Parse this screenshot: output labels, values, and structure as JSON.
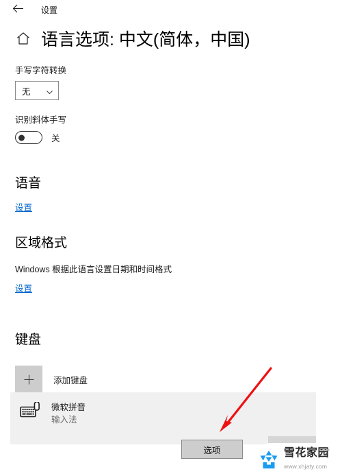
{
  "titlebar": {
    "back_icon": "back-arrow-icon",
    "title": "设置"
  },
  "page": {
    "home_icon": "home-icon",
    "title": "语言选项: 中文(简体，中国)"
  },
  "handwriting": {
    "label": "手写字符转换",
    "dropdown_value": "无",
    "chevron_icon": "chevron-down-icon"
  },
  "cursive": {
    "label": "识别斜体手写",
    "toggle_state": "关",
    "toggle_on": false
  },
  "speech": {
    "title": "语音",
    "settings_link": "设置"
  },
  "region": {
    "title": "区域格式",
    "description": "Windows 根据此语言设置日期和时间格式",
    "settings_link": "设置"
  },
  "keyboard": {
    "title": "键盘",
    "add_icon": "plus-icon",
    "add_label": "添加键盘",
    "ime": {
      "icon": "keyboard-icon",
      "name": "微软拼音",
      "subtitle": "输入法",
      "options_button": "选项"
    }
  },
  "annotation": {
    "arrow_color": "#ee1111",
    "arrow_name": "red-pointer-arrow"
  },
  "watermark": {
    "logo_icon": "snowflake-logo-icon",
    "name": "雪花家园",
    "url": "www.xhjaty.com",
    "accent_color": "#1b9cf0"
  }
}
